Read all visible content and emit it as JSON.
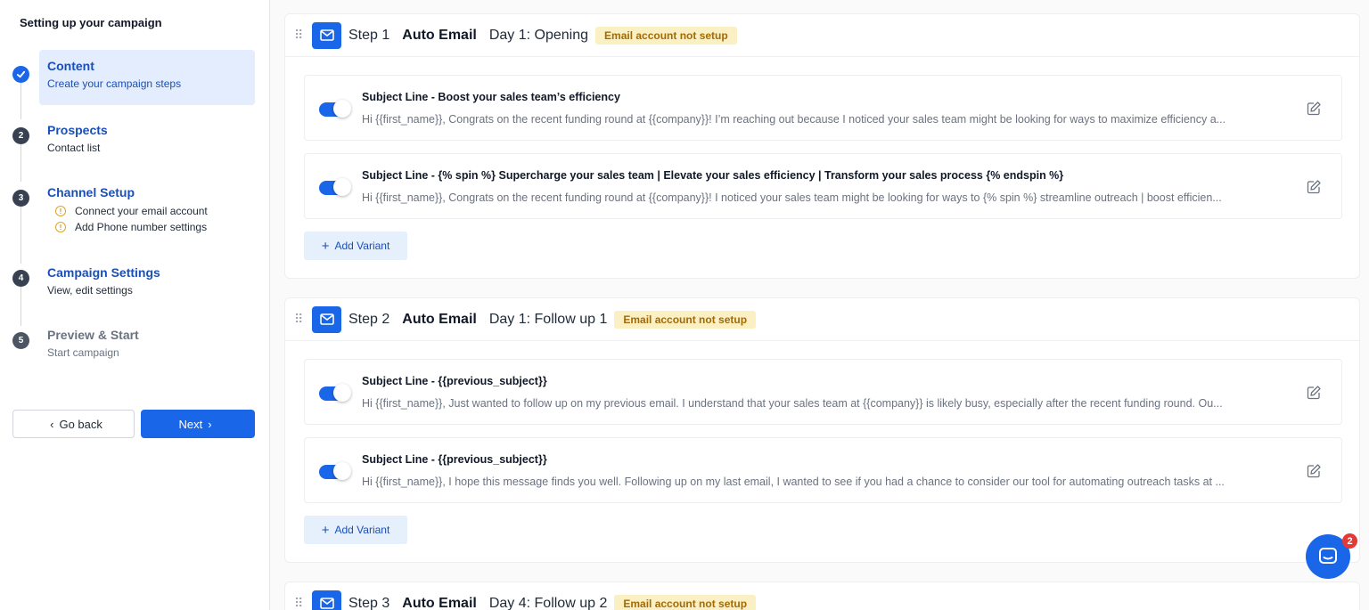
{
  "sidebar": {
    "title": "Setting up your campaign",
    "steps": [
      {
        "num": "",
        "name": "Content",
        "sub": "Create your campaign steps",
        "state": "done"
      },
      {
        "num": "2",
        "name": "Prospects",
        "sub": "Contact list",
        "state": "normal"
      },
      {
        "num": "3",
        "name": "Channel Setup",
        "warnings": [
          "Connect your email account",
          "Add Phone number settings"
        ],
        "state": "normal"
      },
      {
        "num": "4",
        "name": "Campaign Settings",
        "sub": "View, edit settings",
        "state": "normal"
      },
      {
        "num": "5",
        "name": "Preview & Start",
        "sub": "Start campaign",
        "state": "muted"
      }
    ],
    "back_label": "Go back",
    "next_label": "Next"
  },
  "steps": [
    {
      "step": "Step 1",
      "type": "Auto Email",
      "day": "Day 1: Opening",
      "badge": "Email account not setup",
      "variants": [
        {
          "subject": "Subject Line - Boost your sales team’s efficiency",
          "body": "Hi {{first_name}}, Congrats on the recent funding round at {{company}}! I’m reaching out because I noticed your sales team might be looking for ways to maximize efficiency a..."
        },
        {
          "subject": "Subject Line - {% spin %} Supercharge your sales team | Elevate your sales efficiency | Transform your sales process {% endspin %}",
          "body": "Hi {{first_name}}, Congrats on the recent funding round at {{company}}! I noticed your sales team might be looking for ways to {% spin %} streamline outreach | boost efficien..."
        }
      ],
      "add_variant": "Add Variant"
    },
    {
      "step": "Step 2",
      "type": "Auto Email",
      "day": "Day 1: Follow up 1",
      "badge": "Email account not setup",
      "variants": [
        {
          "subject": "Subject Line - {{previous_subject}}",
          "body": "Hi {{first_name}}, Just wanted to follow up on my previous email. I understand that your sales team at {{company}} is likely busy, especially after the recent funding round. Ou..."
        },
        {
          "subject": "Subject Line - {{previous_subject}}",
          "body": "Hi {{first_name}}, I hope this message finds you well. Following up on my last email, I wanted to see if you had a chance to consider our tool for automating outreach tasks at ..."
        }
      ],
      "add_variant": "Add Variant"
    },
    {
      "step": "Step 3",
      "type": "Auto Email",
      "day": "Day 4: Follow up 2",
      "badge": "Email account not setup"
    }
  ],
  "chat": {
    "badge_count": "2"
  },
  "colors": {
    "accent": "#1a66e8",
    "badge_bg": "#fbefc4",
    "badge_text": "#a16c07",
    "warning": "#e0a526"
  }
}
